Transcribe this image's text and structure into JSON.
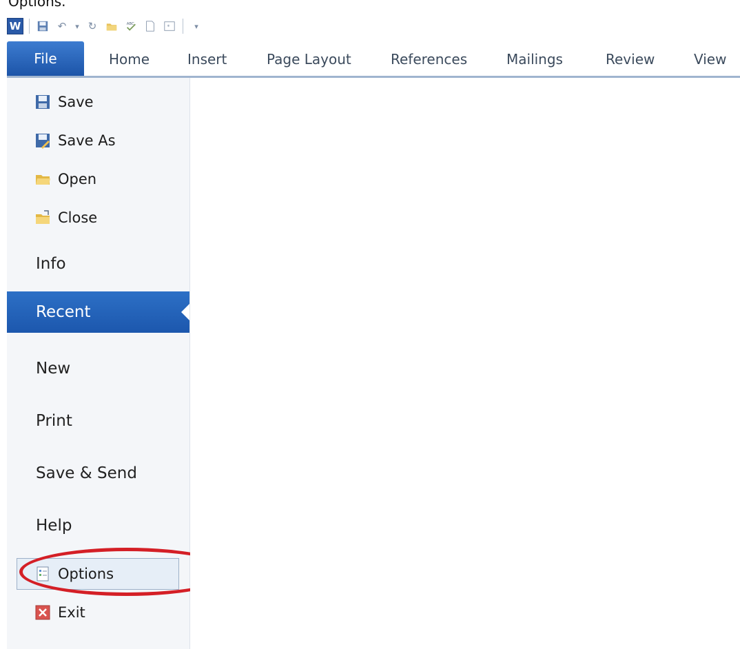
{
  "caption": "Options.",
  "app": {
    "logo_letter": "W"
  },
  "quick_access": {
    "icons": [
      "save-icon",
      "undo-icon",
      "redo-icon",
      "open-folder-icon",
      "spelling-icon",
      "new-document-icon",
      "picture-icon",
      "customize-dropdown-icon"
    ]
  },
  "tabs": [
    {
      "label": "File",
      "active": true
    },
    {
      "label": "Home"
    },
    {
      "label": "Insert"
    },
    {
      "label": "Page Layout"
    },
    {
      "label": "References"
    },
    {
      "label": "Mailings"
    },
    {
      "label": "Review"
    },
    {
      "label": "View"
    }
  ],
  "backstage": {
    "commands": [
      {
        "label": "Save",
        "icon": "save-icon"
      },
      {
        "label": "Save As",
        "icon": "save-as-icon"
      },
      {
        "label": "Open",
        "icon": "open-folder-icon"
      },
      {
        "label": "Close",
        "icon": "close-folder-icon"
      }
    ],
    "sections": [
      {
        "label": "Info"
      },
      {
        "label": "Recent",
        "active": true
      },
      {
        "label": "New"
      },
      {
        "label": "Print"
      },
      {
        "label": "Save & Send"
      },
      {
        "label": "Help"
      }
    ],
    "bottom_commands": [
      {
        "label": "Options",
        "icon": "options-icon",
        "highlighted": true
      },
      {
        "label": "Exit",
        "icon": "exit-icon"
      }
    ]
  },
  "colors": {
    "accent": "#1c57ad",
    "highlight_ring": "#d41f26"
  }
}
